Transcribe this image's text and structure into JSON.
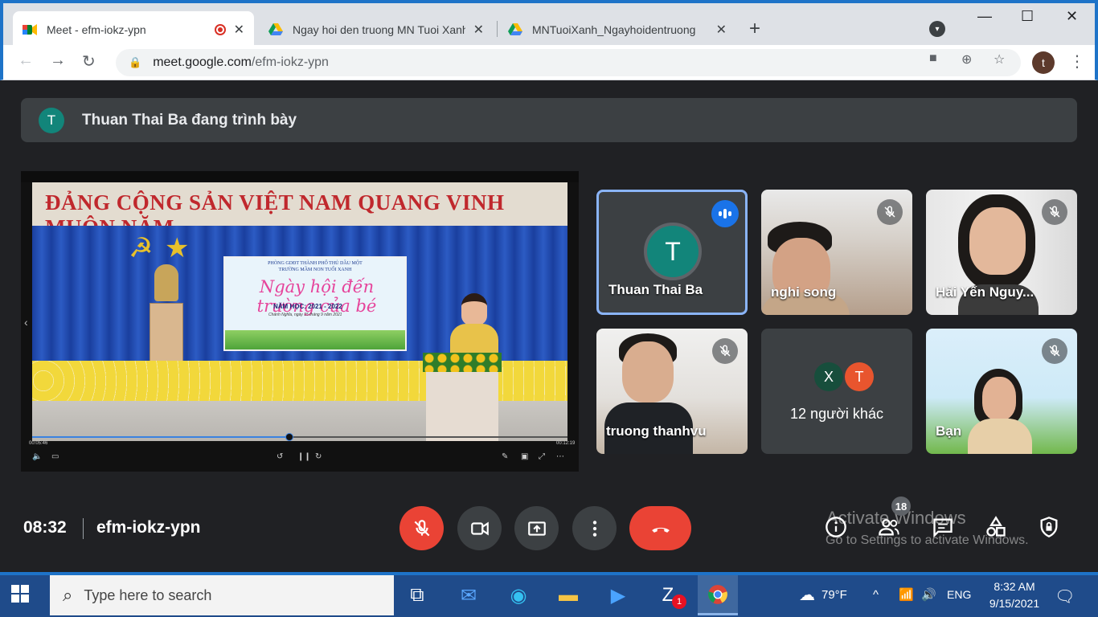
{
  "browser": {
    "tabs": [
      {
        "title": "Meet - efm-iokz-ypn",
        "active": true,
        "recording": true
      },
      {
        "title": "Ngay hoi den truong MN Tuoi Xanh",
        "active": false
      },
      {
        "title": "MNTuoiXanh_Ngayhoidentruong",
        "active": false
      }
    ],
    "url_domain": "meet.google.com",
    "url_path": "/efm-iokz-ypn",
    "profile_initial": "t",
    "colors": {
      "frame": "#1e73c8",
      "tabstrip": "#dee1e6"
    }
  },
  "meet": {
    "presenting_initial": "T",
    "presenting_text": "Thuan Thai Ba đang trình bày",
    "presentation": {
      "slogan": "ĐẢNG CỘNG SẢN VIỆT NAM QUANG VINH MUÔN NĂM",
      "slide_org": "PHÒNG GDĐT THÀNH PHỐ THỦ DẦU MỘT",
      "slide_school": "TRƯỜNG MẦM NON TUỔI XANH",
      "slide_title": "Ngày hội đến trường của bé",
      "slide_year": "NĂM HỌC: 2021 - 2022",
      "slide_date": "Chánh Nghĩa, ngày 15 tháng 9 năm 2021",
      "time_elapsed": "00:05:46",
      "time_total": "00:12:19",
      "progress": 0.48
    },
    "tiles": [
      {
        "name": "Thuan Thai Ba",
        "initial": "T",
        "speaking": true
      },
      {
        "name": "nghi song",
        "muted": true
      },
      {
        "name": "Hải Yến Nguy...",
        "muted": true
      },
      {
        "name": "truong thanhvu",
        "muted": true
      },
      {
        "name": "12 người khác",
        "initials": [
          "X",
          "T"
        ]
      },
      {
        "name": "Bạn",
        "muted": true
      }
    ],
    "time": "08:32",
    "meeting_code": "efm-iokz-ypn",
    "participant_count": "18",
    "watermark_title": "Activate Windows",
    "watermark_sub": "Go to Settings to activate Windows.",
    "colors": {
      "end_call": "#ea4335",
      "speaking_border": "#8ab4f8",
      "avatar": "#12857a"
    }
  },
  "taskbar": {
    "search_placeholder": "Type here to search",
    "zalo_badge": "1",
    "weather": "79°F",
    "language": "ENG",
    "time": "8:32 AM",
    "date": "9/15/2021"
  }
}
